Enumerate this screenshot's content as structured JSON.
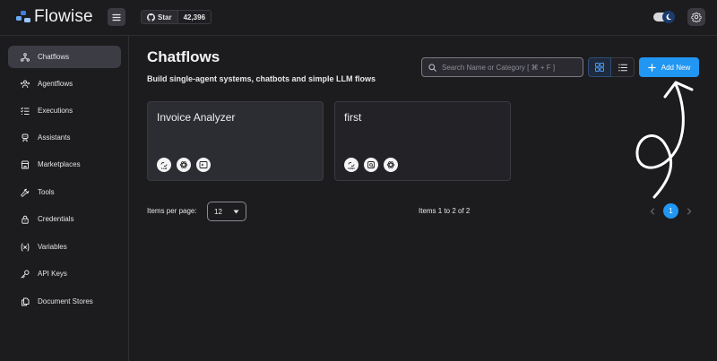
{
  "app": {
    "name": "Flowise"
  },
  "header": {
    "github": {
      "star_label": "Star",
      "star_count": "42,396"
    },
    "icons": {
      "menu": "menu-icon",
      "github": "github-icon",
      "theme": "moon-icon",
      "settings": "gear-icon"
    }
  },
  "sidebar": {
    "items": [
      {
        "label": "Chatflows",
        "icon": "chatflow-icon",
        "active": true
      },
      {
        "label": "Agentflows",
        "icon": "agents-icon"
      },
      {
        "label": "Executions",
        "icon": "list-check-icon"
      },
      {
        "label": "Assistants",
        "icon": "robot-icon"
      },
      {
        "label": "Marketplaces",
        "icon": "building-store-icon"
      },
      {
        "label": "Tools",
        "icon": "tool-icon"
      },
      {
        "label": "Credentials",
        "icon": "lock-icon"
      },
      {
        "label": "Variables",
        "icon": "variable-icon"
      },
      {
        "label": "API Keys",
        "icon": "key-icon"
      },
      {
        "label": "Document Stores",
        "icon": "files-icon"
      }
    ]
  },
  "main": {
    "title": "Chatflows",
    "subtitle": "Build single-agent systems, chatbots and simple LLM flows",
    "search_placeholder": "Search Name or Category [ ⌘ + F ]",
    "add_label": "Add New",
    "view_mode": "grid"
  },
  "cards": [
    {
      "title": "Invoice Analyzer",
      "node_icons": [
        "llm-chain-icon",
        "openai-icon",
        "prompt-icon"
      ]
    },
    {
      "title": "first",
      "node_icons": [
        "conversation-chain-icon",
        "buffer-memory-icon",
        "openai-icon"
      ]
    }
  ],
  "pagination": {
    "items_per_page_label": "Items per page:",
    "items_per_page": "12",
    "range_text": "Items 1 to 2 of 2",
    "current_page": "1"
  },
  "colors": {
    "accent": "#2196f3",
    "background": "#1c1c1f",
    "active_item": "#3c3c44"
  }
}
